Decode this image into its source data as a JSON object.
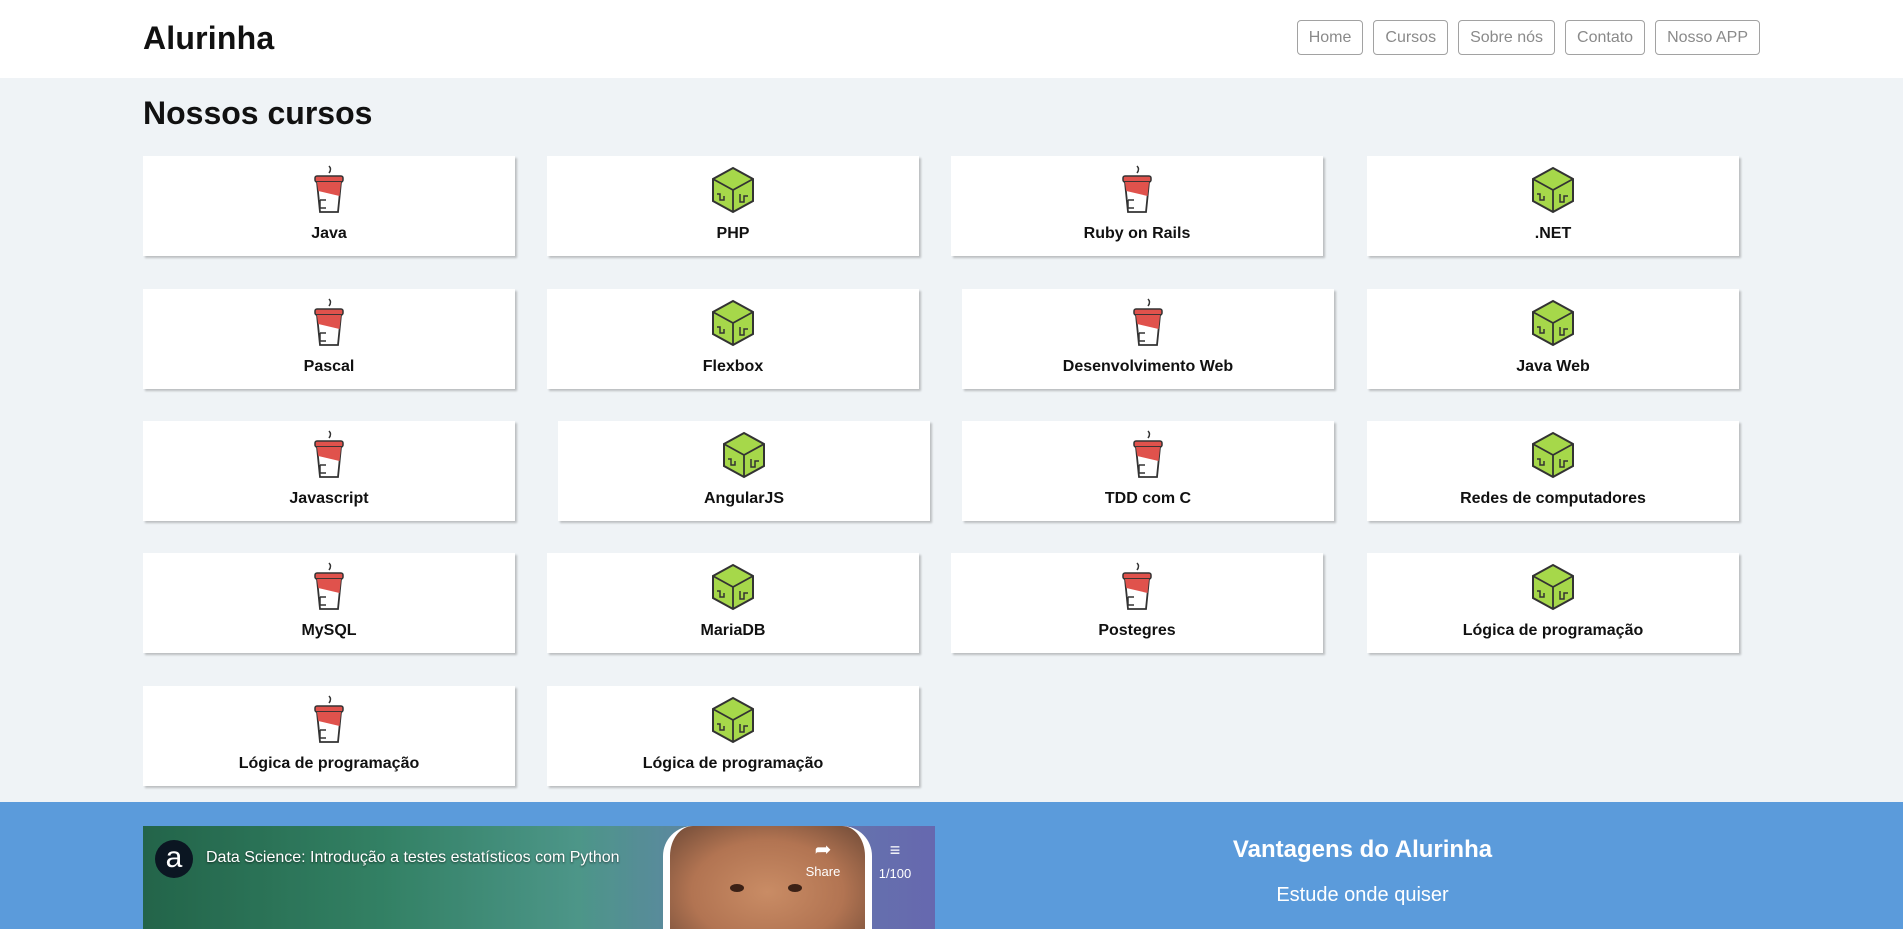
{
  "header": {
    "logo": "Alurinha",
    "nav": [
      "Home",
      "Cursos",
      "Sobre nós",
      "Contato",
      "Nosso APP"
    ]
  },
  "courses_section": {
    "title": "Nossos cursos",
    "courses": [
      {
        "label": "Java",
        "icon": "coffee-cup-icon"
      },
      {
        "label": "PHP",
        "icon": "green-cube-icon"
      },
      {
        "label": "Ruby on Rails",
        "icon": "coffee-cup-icon"
      },
      {
        "label": ".NET",
        "icon": "green-cube-icon"
      },
      {
        "label": "Pascal",
        "icon": "coffee-cup-icon"
      },
      {
        "label": "Flexbox",
        "icon": "green-cube-icon"
      },
      {
        "label": "Desenvolvimento Web",
        "icon": "coffee-cup-icon"
      },
      {
        "label": "Java Web",
        "icon": "green-cube-icon"
      },
      {
        "label": "Javascript",
        "icon": "coffee-cup-icon"
      },
      {
        "label": "AngularJS",
        "icon": "green-cube-icon"
      },
      {
        "label": "TDD com C",
        "icon": "coffee-cup-icon"
      },
      {
        "label": "Redes de computadores",
        "icon": "green-cube-icon"
      },
      {
        "label": "MySQL",
        "icon": "coffee-cup-icon"
      },
      {
        "label": "MariaDB",
        "icon": "green-cube-icon"
      },
      {
        "label": "Postegres",
        "icon": "coffee-cup-icon"
      },
      {
        "label": "Lógica de programação",
        "icon": "green-cube-icon"
      },
      {
        "label": "Lógica de programação",
        "icon": "coffee-cup-icon"
      },
      {
        "label": "Lógica de programação",
        "icon": "green-cube-icon"
      }
    ]
  },
  "video": {
    "title": "Data Science: Introdução a testes estatísticos com Python",
    "channel_icon": "alura-logo-icon",
    "share_label": "Share",
    "playlist_count": "1/100"
  },
  "advantages": {
    "title": "Vantagens do Alurinha",
    "subtitle": "Estude onde quiser"
  },
  "colors": {
    "page_bg": "#eff3f6",
    "footer_bg": "#5b9bdb",
    "cup_red": "#e0524c",
    "cube_green": "#a6d84a"
  }
}
